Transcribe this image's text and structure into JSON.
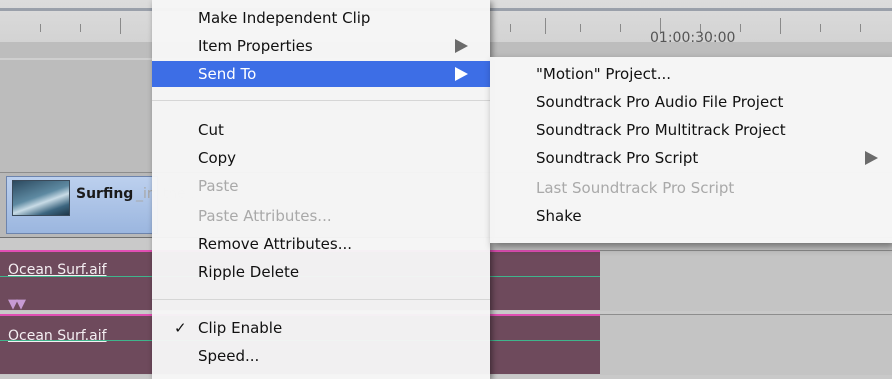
{
  "timeline": {
    "timecode": "01:00:30:00",
    "video_clip_name": "Surfing",
    "video_clip_ghost": "_in_the...",
    "audio_clips": [
      "Ocean Surf.aif",
      "Ocean Surf.aif"
    ]
  },
  "context_menu": {
    "items": [
      {
        "label": "Make Independent Clip"
      },
      {
        "label": "Item Properties",
        "submenu": true
      },
      {
        "label": "Send To",
        "submenu": true,
        "selected": true
      },
      {
        "label": "Cut"
      },
      {
        "label": "Copy"
      },
      {
        "label": "Paste",
        "disabled": true
      },
      {
        "label": "Paste Attributes...",
        "disabled": true
      },
      {
        "label": "Remove Attributes..."
      },
      {
        "label": "Ripple Delete"
      },
      {
        "label": "Clip Enable",
        "checked": true,
        "check_mark": "✓"
      },
      {
        "label": "Speed..."
      }
    ]
  },
  "send_to_submenu": {
    "items": [
      {
        "label": "\"Motion\" Project..."
      },
      {
        "label": "Soundtrack Pro Audio File Project"
      },
      {
        "label": "Soundtrack Pro Multitrack Project"
      },
      {
        "label": "Soundtrack Pro Script",
        "submenu": true
      },
      {
        "label": "Last Soundtrack Pro Script",
        "disabled": true
      },
      {
        "label": "Shake"
      }
    ]
  },
  "colors": {
    "selection": "#3d6ee6",
    "audio_clip": "#6e4a5c",
    "audio_clip_border": "#e14fb4",
    "audio_waveform": "#3fb58c",
    "video_clip": "#9bb6df"
  }
}
